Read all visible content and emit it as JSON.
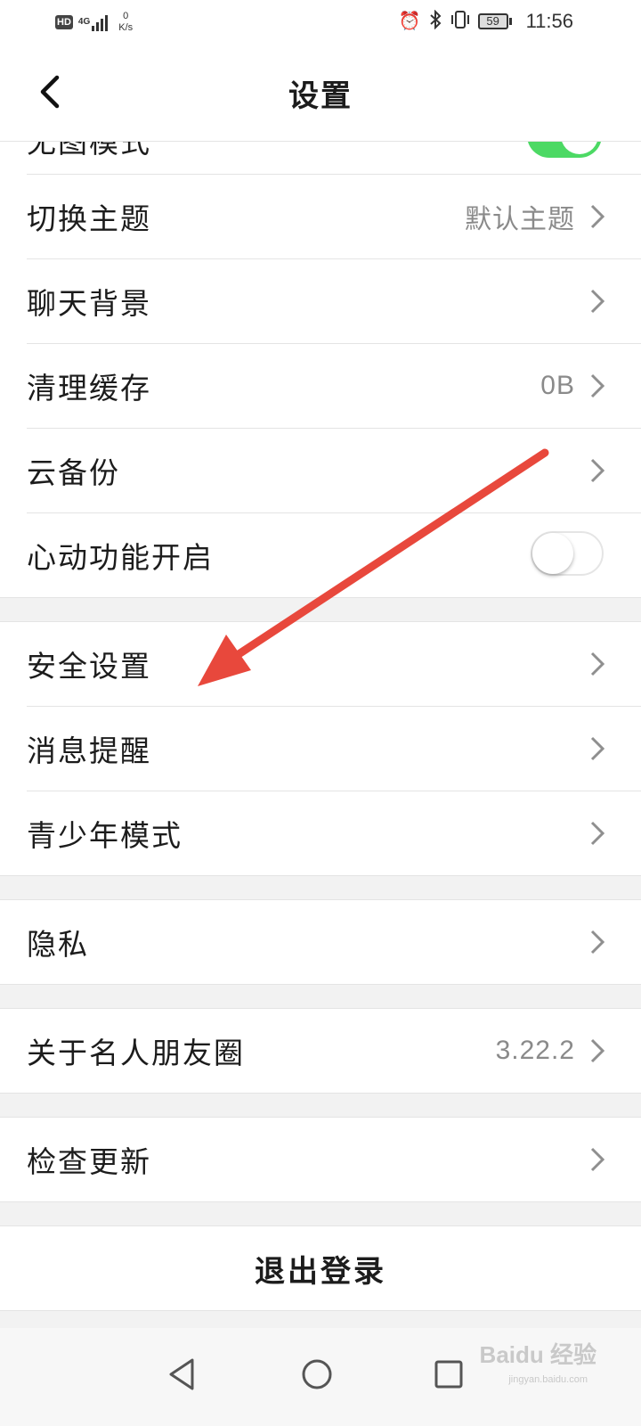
{
  "status_bar": {
    "hd": "HD",
    "network": "4G",
    "speed_value": "0",
    "speed_unit": "K/s",
    "battery": "59",
    "time": "11:56",
    "icons": [
      "alarm-icon",
      "bluetooth-icon",
      "vibrate-icon",
      "battery-icon"
    ]
  },
  "header": {
    "back_icon": "chevron-left-icon",
    "title": "设置"
  },
  "partial_row": {
    "label": "无图模式",
    "toggle_on": true
  },
  "group1": [
    {
      "label": "切换主题",
      "value": "默认主题",
      "chevron": true
    },
    {
      "label": "聊天背景",
      "value": "",
      "chevron": true
    },
    {
      "label": "清理缓存",
      "value": "0B",
      "chevron": true
    },
    {
      "label": "云备份",
      "value": "",
      "chevron": true
    },
    {
      "label": "心动功能开启",
      "toggle_on": false
    }
  ],
  "group2": [
    {
      "label": "安全设置",
      "chevron": true
    },
    {
      "label": "消息提醒",
      "chevron": true
    },
    {
      "label": "青少年模式",
      "chevron": true
    }
  ],
  "group3": [
    {
      "label": "隐私",
      "chevron": true
    }
  ],
  "group4": [
    {
      "label": "关于名人朋友圈",
      "value": "3.22.2",
      "chevron": true
    }
  ],
  "group5": [
    {
      "label": "检查更新",
      "chevron": true
    }
  ],
  "logout": {
    "label": "退出登录"
  },
  "nav_bar": {
    "buttons": [
      "back-triangle-icon",
      "home-circle-icon",
      "recents-square-icon"
    ]
  },
  "watermark": {
    "text": "Baidu 经验",
    "sub": "jingyan.baidu.com"
  },
  "colors": {
    "toggle_on": "#4cd964",
    "arrow": "#e8483c",
    "value_gray": "#8a8a8a",
    "divider": "#e4e4e4",
    "section_gap": "#f2f2f2"
  }
}
